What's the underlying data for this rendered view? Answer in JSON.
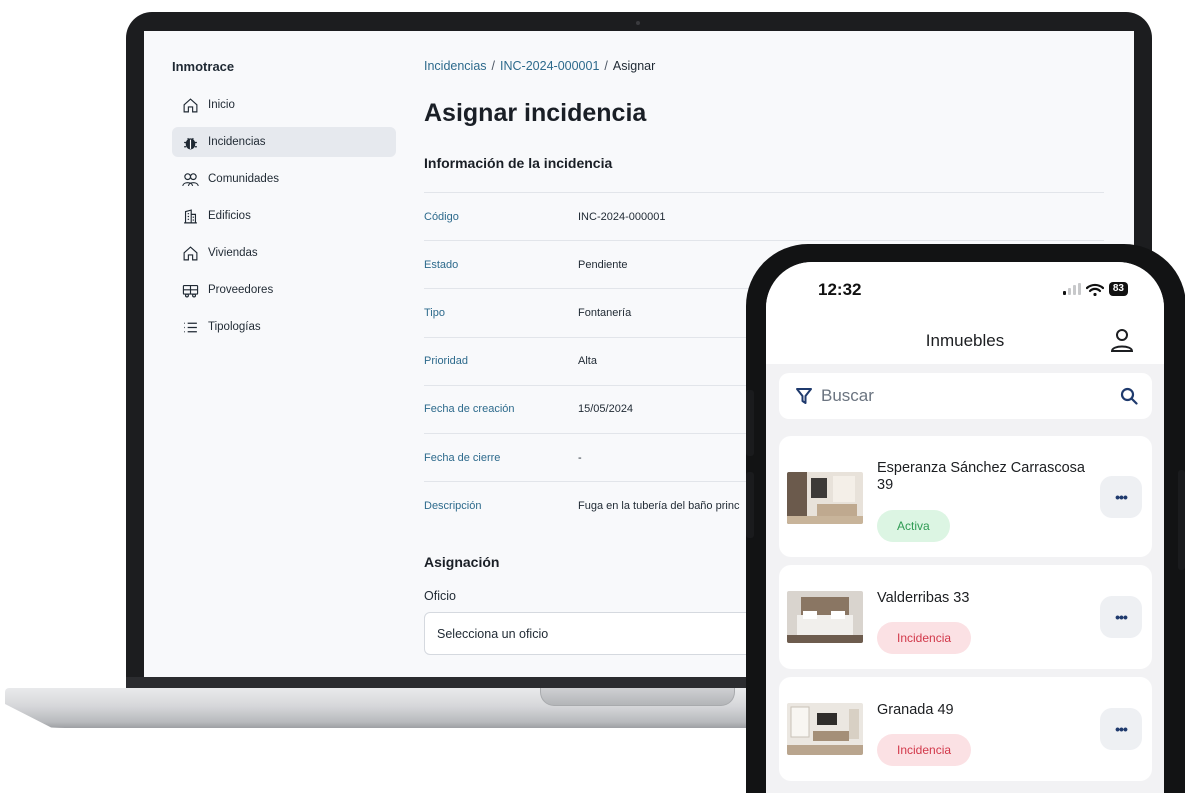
{
  "desktop": {
    "brand": "Inmotrace",
    "nav": [
      {
        "label": "Inicio",
        "icon": "home-icon",
        "active": false
      },
      {
        "label": "Incidencias",
        "icon": "bug-icon",
        "active": true
      },
      {
        "label": "Comunidades",
        "icon": "users-icon",
        "active": false
      },
      {
        "label": "Edificios",
        "icon": "building-icon",
        "active": false
      },
      {
        "label": "Viviendas",
        "icon": "house-icon",
        "active": false
      },
      {
        "label": "Proveedores",
        "icon": "truck-icon",
        "active": false
      },
      {
        "label": "Tipologías",
        "icon": "list-icon",
        "active": false
      }
    ],
    "breadcrumb": {
      "items": [
        "Incidencias",
        "INC-2024-000001"
      ],
      "separator": "/",
      "current": "Asignar"
    },
    "page_title": "Asignar incidencia",
    "info_section_title": "Información de la incidencia",
    "info_rows": [
      {
        "key": "Código",
        "value": "INC-2024-000001"
      },
      {
        "key": "Estado",
        "value": "Pendiente"
      },
      {
        "key": "Tipo",
        "value": "Fontanería"
      },
      {
        "key": "Prioridad",
        "value": "Alta"
      },
      {
        "key": "Fecha de creación",
        "value": "15/05/2024"
      },
      {
        "key": "Fecha de cierre",
        "value": "-"
      },
      {
        "key": "Descripción",
        "value": "Fuga en la tubería del baño princ"
      }
    ],
    "assign_section_title": "Asignación",
    "trade_label": "Oficio",
    "trade_placeholder": "Selecciona un oficio"
  },
  "mobile": {
    "time": "12:32",
    "battery": "83",
    "title": "Inmuebles",
    "search_placeholder": "Buscar",
    "cards": [
      {
        "name": "Esperanza Sánchez Carrascosa 39",
        "status": "Activa",
        "status_type": "active"
      },
      {
        "name": "Valderribas 33",
        "status": "Incidencia",
        "status_type": "alert"
      },
      {
        "name": "Granada 49",
        "status": "Incidencia",
        "status_type": "alert"
      }
    ],
    "more_label": "•••"
  },
  "colors": {
    "link": "#2d6a8c",
    "active_nav_bg": "#e6e9ee",
    "badge_active_bg": "#dcf5e3",
    "badge_active_text": "#2f9b53",
    "badge_alert_bg": "#fbe1e4",
    "badge_alert_text": "#d2384a"
  }
}
